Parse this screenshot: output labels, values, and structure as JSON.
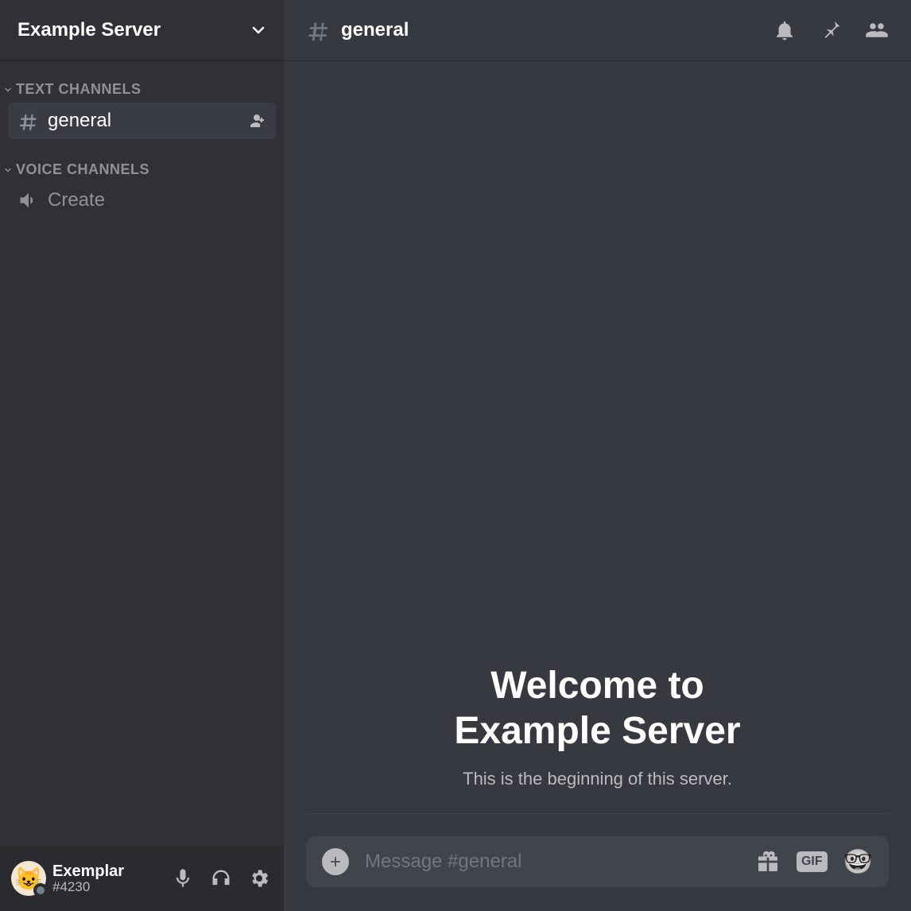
{
  "server": {
    "name": "Example Server"
  },
  "sidebar": {
    "categories": {
      "text_label": "TEXT CHANNELS",
      "voice_label": "VOICE CHANNELS"
    },
    "channels": {
      "general": "general",
      "voice_create": "Create"
    }
  },
  "header": {
    "channel_name": "general"
  },
  "welcome": {
    "line1": "Welcome to",
    "line2": "Example Server",
    "subtitle": "This is the beginning of this server."
  },
  "composer": {
    "placeholder": "Message #general",
    "gif_label": "GIF"
  },
  "user": {
    "name": "Exemplar",
    "tag": "#4230"
  }
}
